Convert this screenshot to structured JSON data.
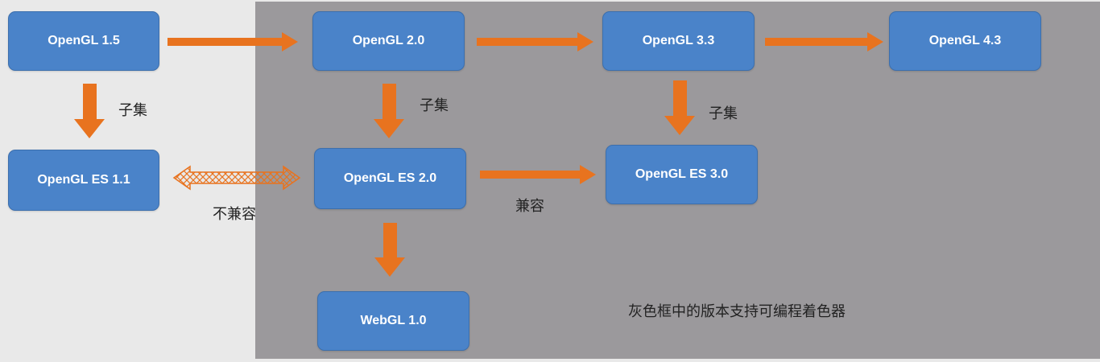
{
  "colors": {
    "left_background": "#e9e9e9",
    "gray_region": "#9b999c",
    "node_fill": "#4a83c9",
    "node_border": "#3c6fad",
    "arrow_fill": "#e8731f",
    "incompatible_arrow_border": "#e8731f",
    "text": "#222222"
  },
  "nodes": {
    "opengl_1_5": "OpenGL 1.5",
    "opengl_2_0": "OpenGL 2.0",
    "opengl_3_3": "OpenGL 3.3",
    "opengl_4_3": "OpenGL 4.3",
    "opengl_es_1_1": "OpenGL ES 1.1",
    "opengl_es_2_0": "OpenGL ES 2.0",
    "opengl_es_3_0": "OpenGL ES 3.0",
    "webgl_1_0": "WebGL 1.0"
  },
  "edge_labels": {
    "subset_1": "子集",
    "subset_2": "子集",
    "subset_3": "子集",
    "incompatible": "不兼容",
    "compatible": "兼容"
  },
  "note": "灰色框中的版本支持可编程着色器"
}
